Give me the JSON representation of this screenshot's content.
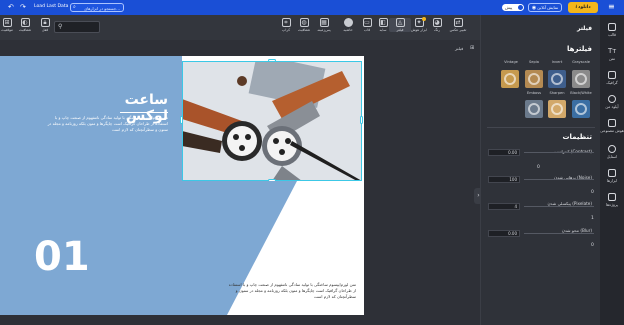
{
  "topbar": {
    "download_label": "دانلود",
    "preview_label": "نمایش آنلاین",
    "draft_label": "پیش",
    "search_placeholder": "جستجو در ابزارهای...",
    "file_name": "Load Last Data",
    "colors": {
      "bar": "#1a4fd6",
      "download_btn": "#f3b61b"
    }
  },
  "toolbar": {
    "items": [
      {
        "label": "تغییر عکس",
        "icon": "replace-image-icon"
      },
      {
        "label": "رنگ",
        "icon": "palette-icon"
      },
      {
        "label": "ابزار هوش",
        "icon": "ai-tools-icon"
      },
      {
        "label": "فیلتر",
        "icon": "filter-icon"
      },
      {
        "label": "سایه",
        "icon": "shadow-icon"
      },
      {
        "label": "قاب",
        "icon": "frame-icon"
      },
      {
        "label": "حاشیه",
        "icon": "border-icon"
      },
      {
        "label": "پس‌زمینه",
        "icon": "background-icon"
      },
      {
        "label": "شفافیت",
        "icon": "opacity-icon"
      },
      {
        "label": "کراپ",
        "icon": "crop-icon"
      }
    ],
    "right_items": [
      {
        "label": "موقعیت",
        "icon": "position-icon"
      },
      {
        "label": "شفافیت",
        "icon": "transparency-icon"
      },
      {
        "label": "قفل",
        "icon": "lock-icon"
      }
    ]
  },
  "page": {
    "title": "ساعت لوکس",
    "number": "01",
    "body_text": "متن لورم‌ایپسوم ساختگی با تولید سادگی نامفهوم از صنعت چاپ و با استفاده از طراحان گرافیک است چاپگرها و متون بلکه روزنامه و مجله در ستون و سطرآنچنان که لازم است",
    "lower_text": "متن لورم‌ایپسوم ساختگی با تولید سادگی نامفهوم از صنعت چاپ و با استفاده از طراحان گرافیک است چاپگرها و متون بلکه روزنامه و مجله در ستون و سطرآنچنان که لازم است",
    "grid_label": "فیلتر",
    "colors": {
      "blue": "#7ea8d3",
      "photo_bg": "#e7eaee"
    }
  },
  "panel": {
    "title": "فیلتر",
    "filters_heading": "فیلترها",
    "filters": [
      {
        "name": "Grayscale",
        "color": "#8a8a8a"
      },
      {
        "name": "Invert",
        "color": "#3e5e8c"
      },
      {
        "name": "Sepia",
        "color": "#b48a52"
      },
      {
        "name": "Vintage",
        "color": "#c69a4e"
      },
      {
        "name": "Black/White",
        "color": "#7d7d7d"
      },
      {
        "name": "Sharpen",
        "color": "#6b7a8c"
      },
      {
        "name": "Emboss",
        "color": "#b5894a"
      },
      {
        "name": "",
        "color": "#3b6ea3"
      },
      {
        "name": "",
        "color": "#d2a86a"
      }
    ],
    "settings_heading": "تنظیمات",
    "sliders": [
      {
        "label": "کنتراست (Contrast)",
        "input": "0.00",
        "value": "0"
      },
      {
        "label": "برهانی شدن (Noise)",
        "input": "100",
        "value": "0"
      },
      {
        "label": "پیکسلی شدن (Pixelate)",
        "input": "4",
        "value": "1"
      },
      {
        "label": "محو شدن (Blur)",
        "input": "0.00",
        "value": "0"
      }
    ]
  },
  "rail": {
    "items": [
      {
        "label": "قالب",
        "icon": "template-icon"
      },
      {
        "label": "متن",
        "icon": "text-icon"
      },
      {
        "label": "گرافیک",
        "icon": "graphics-icon"
      },
      {
        "label": "آپلود من",
        "icon": "upload-icon"
      },
      {
        "label": "هوش مصنوعی",
        "icon": "ai-icon"
      },
      {
        "label": "استایل",
        "icon": "style-icon"
      },
      {
        "label": "ابزارها",
        "icon": "tools-icon"
      },
      {
        "label": "پروژه‌ها",
        "icon": "projects-icon"
      }
    ]
  }
}
